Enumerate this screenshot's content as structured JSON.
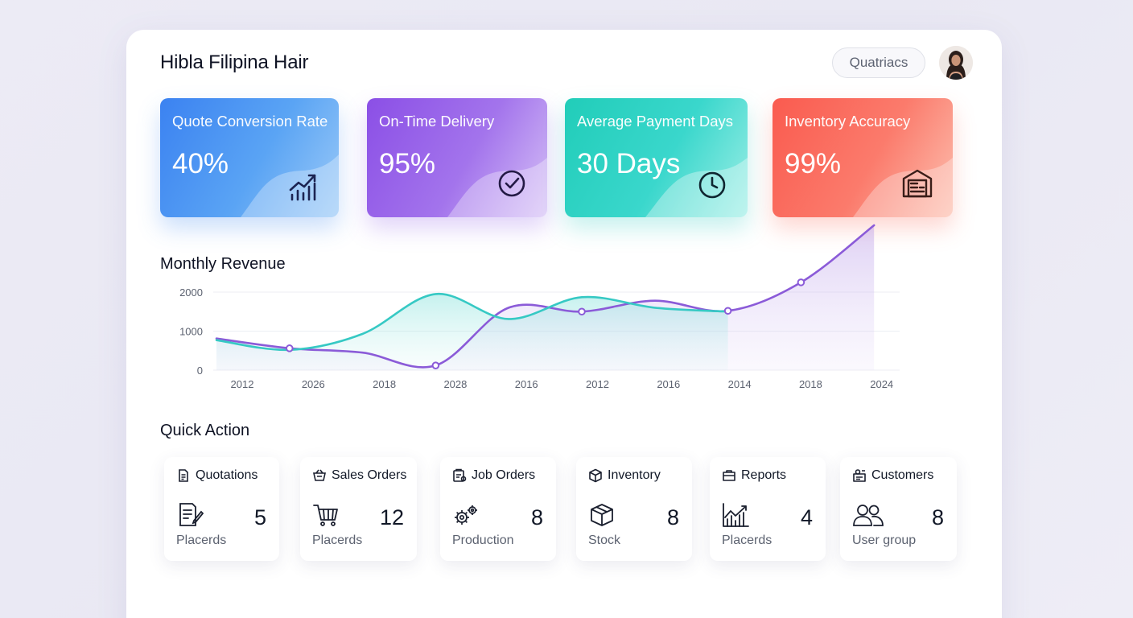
{
  "app": {
    "title": "Hibla Filipina Hair",
    "header_button": "Quatriacs"
  },
  "kpis": [
    {
      "title": "Quote Conversion Rate",
      "value": "40%",
      "icon": "trend-up-chart-icon",
      "color": "#3b82f1"
    },
    {
      "title": "On-Time Delivery",
      "value": "95%",
      "icon": "check-circle-icon",
      "color": "#8b4fe6"
    },
    {
      "title": "Average Payment Days",
      "value": "30 Days",
      "icon": "clock-icon",
      "color": "#21cdb9"
    },
    {
      "title": "Inventory Accuracy",
      "value": "99%",
      "icon": "warehouse-icon",
      "color": "#fa5b4f"
    }
  ],
  "revenue": {
    "title": "Monthly Revenue"
  },
  "chart_data": {
    "type": "area",
    "title": "Monthly Revenue",
    "categories": [
      "2012",
      "2026",
      "2018",
      "2028",
      "2016",
      "2012",
      "2016",
      "2014",
      "2018",
      "2024"
    ],
    "y_ticks": [
      "2000",
      "1000",
      "0"
    ],
    "ylim": [
      0,
      2000
    ],
    "grid": true,
    "series": [
      {
        "color": "#8b5bd8",
        "values": [
          810,
          560,
          450,
          120,
          1600,
          1500,
          1780,
          1520,
          2250,
          4300
        ]
      },
      {
        "color": "#36c9c4",
        "values": [
          770,
          520,
          930,
          1950,
          1310,
          1870,
          1600,
          1500
        ]
      }
    ]
  },
  "quick_action": {
    "title": "Quick Action",
    "items": [
      {
        "label": "Quotations",
        "count": "5",
        "sub": "Placerds",
        "icon": "quotation-doc-icon"
      },
      {
        "label": "Sales Orders",
        "count": "12",
        "sub": "Placerds",
        "icon": "shopping-cart-icon"
      },
      {
        "label": "Job Orders",
        "count": "8",
        "sub": "Production",
        "icon": "gears-icon"
      },
      {
        "label": "Inventory",
        "count": "8",
        "sub": "Stock",
        "icon": "box-icon"
      },
      {
        "label": "Reports",
        "count": "4",
        "sub": "Placerds",
        "icon": "bar-chart-icon"
      },
      {
        "label": "Customers",
        "count": "8",
        "sub": "User group",
        "icon": "users-icon"
      }
    ]
  }
}
